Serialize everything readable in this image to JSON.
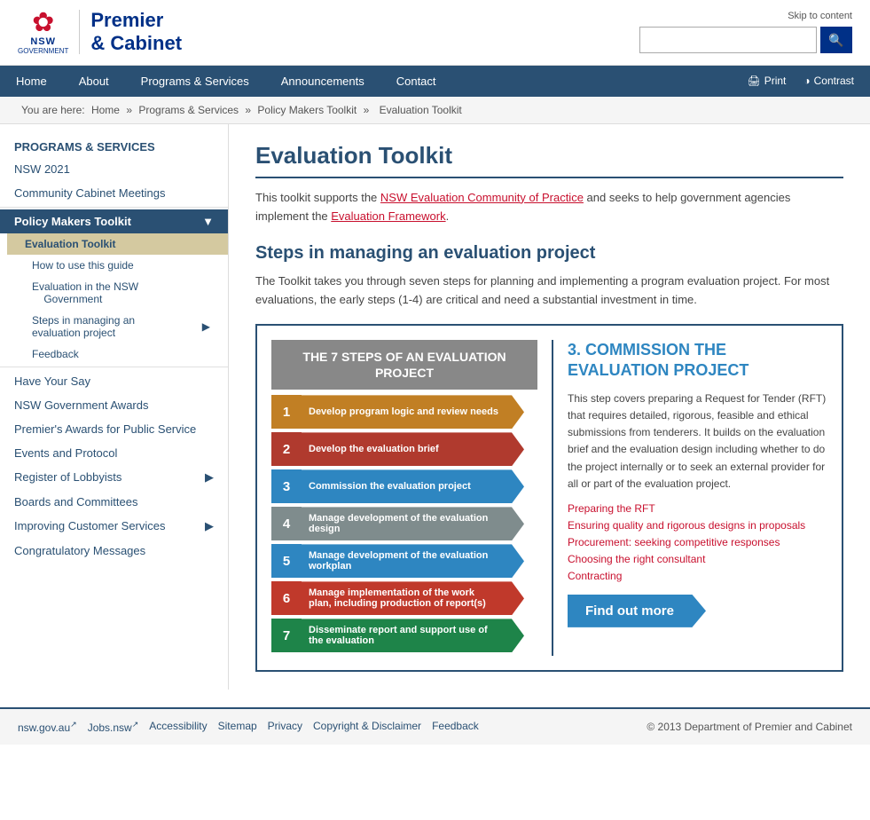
{
  "header": {
    "skip_link": "Skip to content",
    "logo_lotus": "❀",
    "logo_nsw": "NSW",
    "logo_gov": "GOVERNMENT",
    "logo_title_line1": "Premier",
    "logo_title_line2": "& Cabinet",
    "search_placeholder": "",
    "search_icon": "🔍"
  },
  "nav": {
    "items": [
      {
        "label": "Home",
        "active": false
      },
      {
        "label": "About",
        "active": false
      },
      {
        "label": "Programs & Services",
        "active": false
      },
      {
        "label": "Announcements",
        "active": false
      },
      {
        "label": "Contact",
        "active": false
      }
    ],
    "print_label": "Print",
    "contrast_label": "Contrast"
  },
  "breadcrumb": {
    "items": [
      "Home",
      "Programs & Services",
      "Policy Makers Toolkit",
      "Evaluation Toolkit"
    ]
  },
  "sidebar": {
    "section_title": "PROGRAMS & SERVICES",
    "items": [
      {
        "label": "NSW 2021",
        "type": "link"
      },
      {
        "label": "Community Cabinet Meetings",
        "type": "link"
      },
      {
        "label": "Policy Makers Toolkit",
        "type": "active-parent"
      },
      {
        "label": "Evaluation Toolkit",
        "type": "active-child"
      },
      {
        "label": "How to use this guide",
        "type": "sub"
      },
      {
        "label": "Evaluation in the NSW Government",
        "type": "sub"
      },
      {
        "label": "Steps in managing an evaluation project",
        "type": "sub-arrow"
      },
      {
        "label": "Feedback",
        "type": "sub"
      },
      {
        "label": "Have Your Say",
        "type": "link"
      },
      {
        "label": "NSW Government Awards",
        "type": "link"
      },
      {
        "label": "Premier's Awards for Public Service",
        "type": "link"
      },
      {
        "label": "Events and Protocol",
        "type": "link"
      },
      {
        "label": "Register of Lobbyists",
        "type": "link-arrow"
      },
      {
        "label": "Boards and Committees",
        "type": "link"
      },
      {
        "label": "Improving Customer Services",
        "type": "link-arrow"
      },
      {
        "label": "Congratulatory Messages",
        "type": "link"
      }
    ]
  },
  "main": {
    "title": "Evaluation Toolkit",
    "intro": "This toolkit supports the NSW Evaluation Community of Practice and seeks to help government agencies implement the Evaluation Framework.",
    "intro_link1": "NSW Evaluation Community of Practice",
    "intro_link2": "Evaluation Framework",
    "steps_section_title": "Steps in managing an evaluation project",
    "steps_desc": "The Toolkit takes you through seven steps for planning and implementing a program evaluation project. For most evaluations, the early steps (1-4) are critical and need a substantial investment in time.",
    "infographic": {
      "header": "THE 7 STEPS OF AN EVALUATION PROJECT",
      "steps": [
        {
          "num": "1",
          "label": "Develop program logic and review needs",
          "color": "#c17f24"
        },
        {
          "num": "2",
          "label": "Develop the evaluation brief",
          "color": "#b03a2e"
        },
        {
          "num": "3",
          "label": "Commission the evaluation project",
          "color": "#2e86c1"
        },
        {
          "num": "4",
          "label": "Manage development of the evaluation design",
          "color": "#7f8c8d"
        },
        {
          "num": "5",
          "label": "Manage development of the evaluation workplan",
          "color": "#2e86c1"
        },
        {
          "num": "6",
          "label": "Manage implementation of the work plan, including production of report(s)",
          "color": "#c0392b"
        },
        {
          "num": "7",
          "label": "Disseminate report and support use of the evaluation",
          "color": "#1e8449"
        }
      ]
    },
    "panel": {
      "title": "3. COMMISSION THE EVALUATION PROJECT",
      "desc": "This step covers preparing a Request for Tender (RFT) that requires detailed, rigorous, feasible and ethical submissions from tenderers. It builds on the evaluation brief and the evaluation design including whether to do the project internally or to seek an external provider for all or part of the evaluation project.",
      "links": [
        "Preparing the RFT",
        "Ensuring quality and rigorous designs in proposals",
        "Procurement: seeking competitive responses",
        "Choosing the right consultant",
        "Contracting"
      ],
      "find_more": "Find out more"
    }
  },
  "footer": {
    "links": [
      {
        "label": "nsw.gov.au",
        "external": true
      },
      {
        "label": "Jobs.nsw",
        "external": true
      },
      {
        "label": "Accessibility"
      },
      {
        "label": "Sitemap"
      },
      {
        "label": "Privacy"
      },
      {
        "label": "Copyright & Disclaimer"
      },
      {
        "label": "Feedback"
      }
    ],
    "copyright": "© 2013 Department of Premier and Cabinet"
  }
}
